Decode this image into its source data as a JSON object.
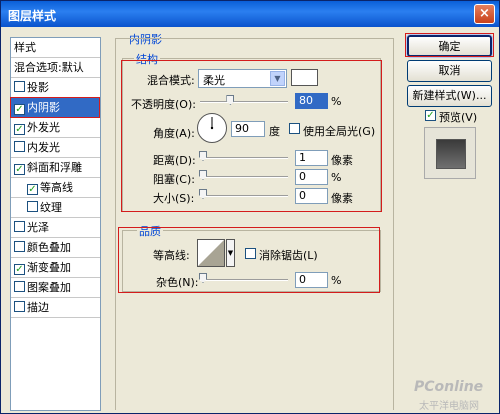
{
  "window": {
    "title": "图层样式",
    "close_glyph": "×"
  },
  "style_list": {
    "header": "样式",
    "blending": "混合选项:默认",
    "items": [
      {
        "label": "投影",
        "checked": false
      },
      {
        "label": "内阴影",
        "checked": true,
        "selected": true
      },
      {
        "label": "外发光",
        "checked": true
      },
      {
        "label": "内发光",
        "checked": false
      },
      {
        "label": "斜面和浮雕",
        "checked": true
      },
      {
        "label": "等高线",
        "checked": true,
        "sub": true
      },
      {
        "label": "纹理",
        "checked": false,
        "sub": true
      },
      {
        "label": "光泽",
        "checked": false
      },
      {
        "label": "颜色叠加",
        "checked": false
      },
      {
        "label": "渐变叠加",
        "checked": true
      },
      {
        "label": "图案叠加",
        "checked": false
      },
      {
        "label": "描边",
        "checked": false
      }
    ]
  },
  "inner_shadow": {
    "section_title": "内阴影",
    "structure": {
      "title": "结构",
      "blend_mode_label": "混合模式:",
      "blend_mode_value": "柔光",
      "opacity_label": "不透明度(O):",
      "opacity_value": "80",
      "opacity_unit": "%",
      "angle_label": "角度(A):",
      "angle_value": "90",
      "angle_unit": "度",
      "global_light_label": "使用全局光(G)",
      "distance_label": "距离(D):",
      "distance_value": "1",
      "distance_unit": "像素",
      "choke_label": "阻塞(C):",
      "choke_value": "0",
      "choke_unit": "%",
      "size_label": "大小(S):",
      "size_value": "0",
      "size_unit": "像素"
    },
    "quality": {
      "title": "品质",
      "contour_label": "等高线:",
      "antialias_label": "消除锯齿(L)",
      "noise_label": "杂色(N):",
      "noise_value": "0",
      "noise_unit": "%"
    }
  },
  "buttons": {
    "ok": "确定",
    "cancel": "取消",
    "new_style": "新建样式(W)...",
    "preview_label": "预览(V)"
  },
  "watermark": {
    "text": "PConline",
    "subtext": "太平洋电脑网"
  },
  "colors": {
    "accent": "#316ac5",
    "highlight_red": "#d41c1c",
    "group_label": "#0046d5"
  }
}
